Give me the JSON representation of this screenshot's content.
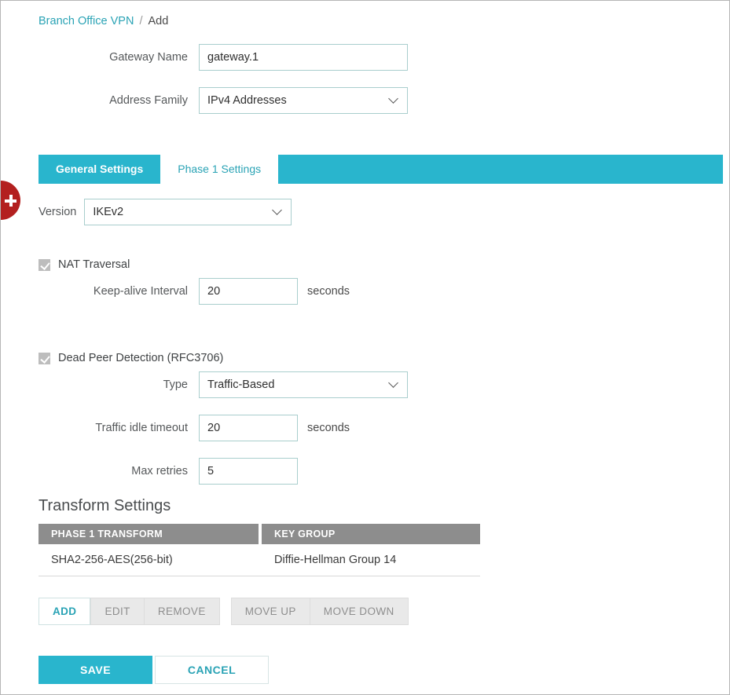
{
  "breadcrumb": {
    "parent": "Branch Office VPN",
    "separator": "/",
    "current": "Add"
  },
  "plus_badge": {
    "icon": "plus-icon",
    "color": "#b3201f"
  },
  "form": {
    "gateway_name": {
      "label": "Gateway Name",
      "value": "gateway.1"
    },
    "address_family": {
      "label": "Address Family",
      "value": "IPv4 Addresses"
    }
  },
  "tabs": [
    {
      "label": "General Settings",
      "active": false
    },
    {
      "label": "Phase 1 Settings",
      "active": true
    }
  ],
  "phase1": {
    "version": {
      "label": "Version",
      "value": "IKEv2"
    },
    "nat_traversal": {
      "label": "NAT Traversal",
      "checked": true,
      "keep_alive": {
        "label": "Keep-alive Interval",
        "value": "20",
        "unit": "seconds"
      }
    },
    "dead_peer_detection": {
      "label": "Dead Peer Detection (RFC3706)",
      "checked": true,
      "type": {
        "label": "Type",
        "value": "Traffic-Based"
      },
      "traffic_idle_timeout": {
        "label": "Traffic idle timeout",
        "value": "20",
        "unit": "seconds"
      },
      "max_retries": {
        "label": "Max retries",
        "value": "5"
      }
    }
  },
  "transform_settings": {
    "title": "Transform Settings",
    "columns": [
      "PHASE 1 TRANSFORM",
      "KEY GROUP"
    ],
    "rows": [
      {
        "phase1_transform": "SHA2-256-AES(256-bit)",
        "key_group": "Diffie-Hellman Group 14"
      }
    ],
    "actions": {
      "add": "ADD",
      "edit": "EDIT",
      "remove": "REMOVE",
      "move_up": "MOVE UP",
      "move_down": "MOVE DOWN"
    }
  },
  "footer": {
    "save": "SAVE",
    "cancel": "CANCEL"
  },
  "colors": {
    "accent": "#29b5cd",
    "link": "#2aa3b5",
    "badge_red": "#b3201f",
    "table_header": "#8d8d8d",
    "field_border": "#a9cecd"
  }
}
